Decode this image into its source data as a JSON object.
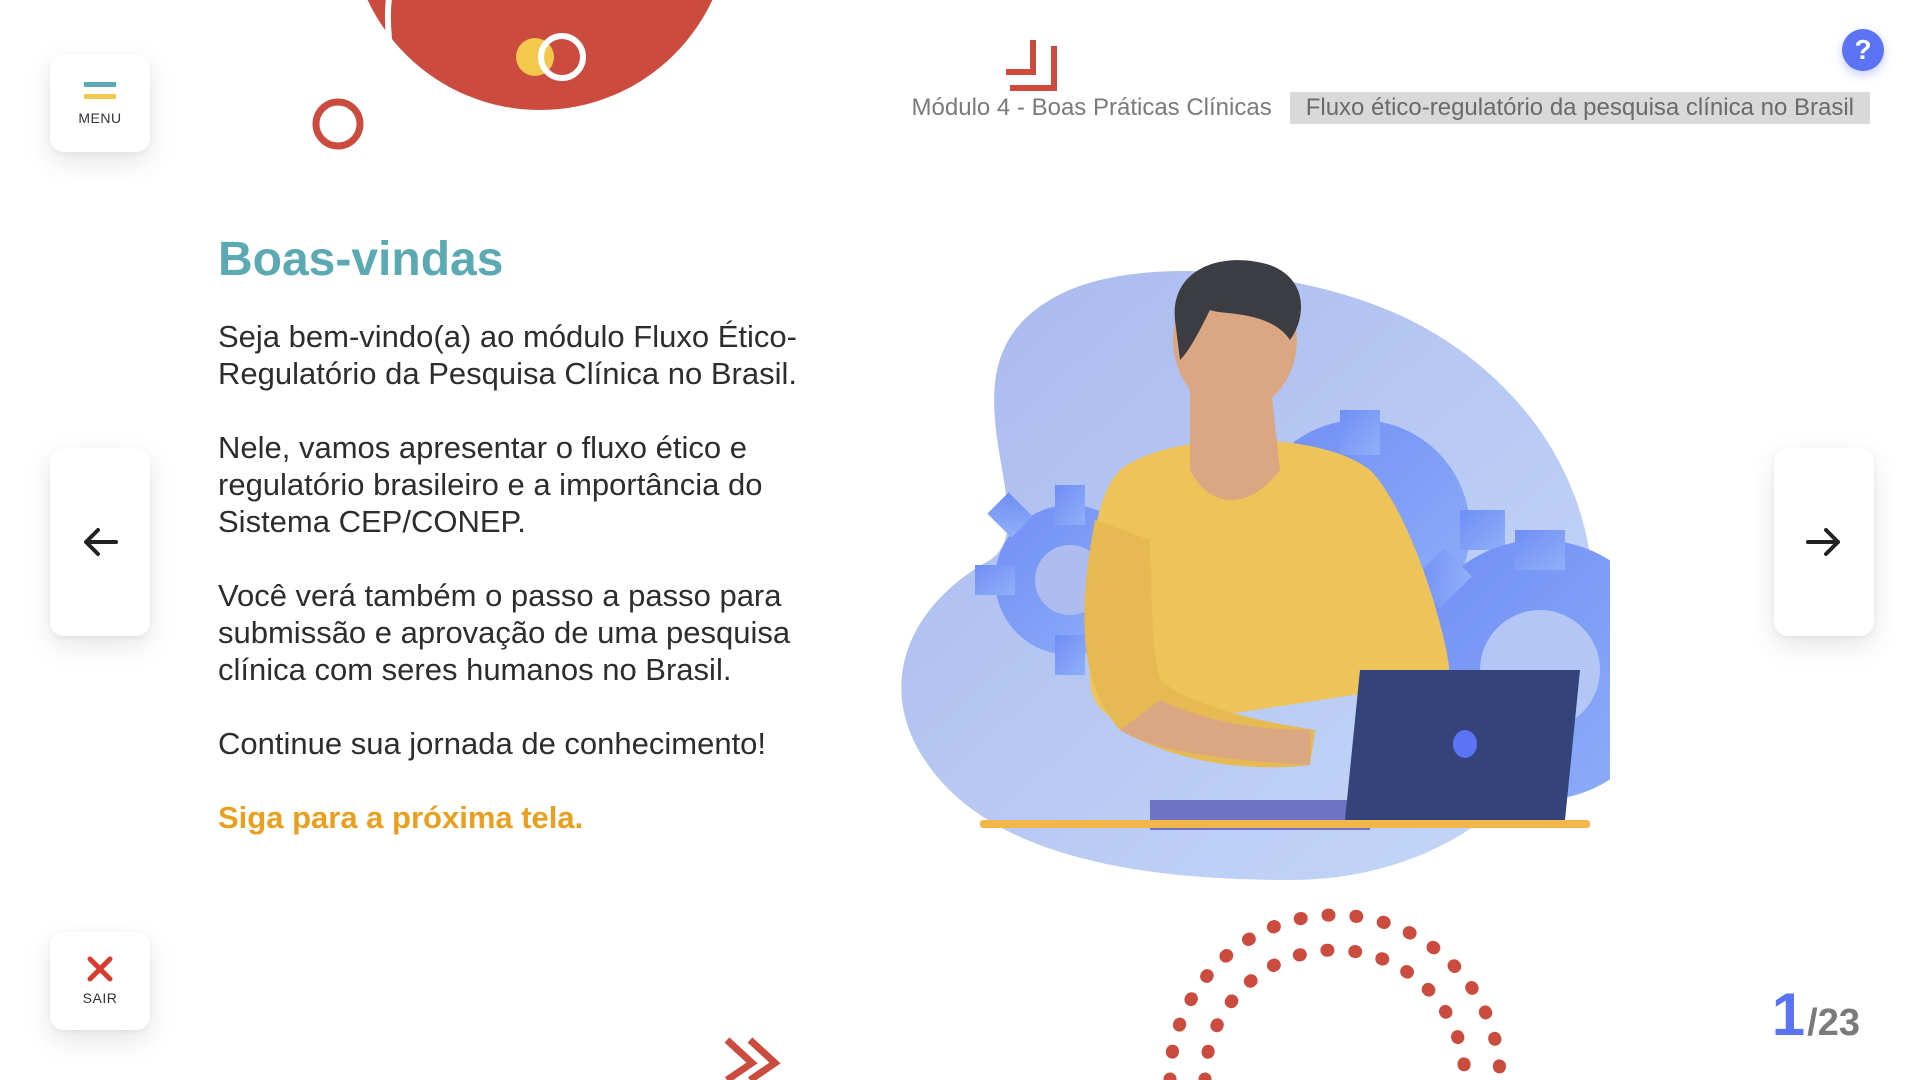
{
  "menu": {
    "label": "MENU",
    "icon": "menu-icon"
  },
  "exit": {
    "label": "SAIR",
    "icon": "close-icon"
  },
  "help": {
    "label": "?",
    "icon": "help-icon"
  },
  "nav": {
    "prev_icon": "arrow-left-icon",
    "next_icon": "arrow-right-icon"
  },
  "breadcrumb": {
    "module": "Módulo 4 - Boas Práticas Clínicas",
    "topic": "Fluxo ético-regulatório da pesquisa clínica no Brasil"
  },
  "content": {
    "title": "Boas-vindas",
    "paragraphs": [
      "Seja bem-vindo(a) ao módulo Fluxo Ético-Regulatório da Pesquisa Clínica no Brasil.",
      "Nele, vamos apresentar o fluxo ético e regulatório brasileiro e a importância do Sistema CEP/CONEP.",
      "Você verá também o passo a passo para submissão e aprovação de uma pesquisa clínica com seres humanos no Brasil.",
      "Continue sua jornada de conhecimento!"
    ],
    "cta": "Siga para a próxima tela."
  },
  "pagination": {
    "current": "1",
    "total": "/23"
  },
  "colors": {
    "accent_teal": "#5aa9b3",
    "accent_orange": "#eaa01e",
    "accent_blue": "#5b73f5",
    "decor_red": "#cc4b3f",
    "decor_yellow": "#f2c94c"
  }
}
